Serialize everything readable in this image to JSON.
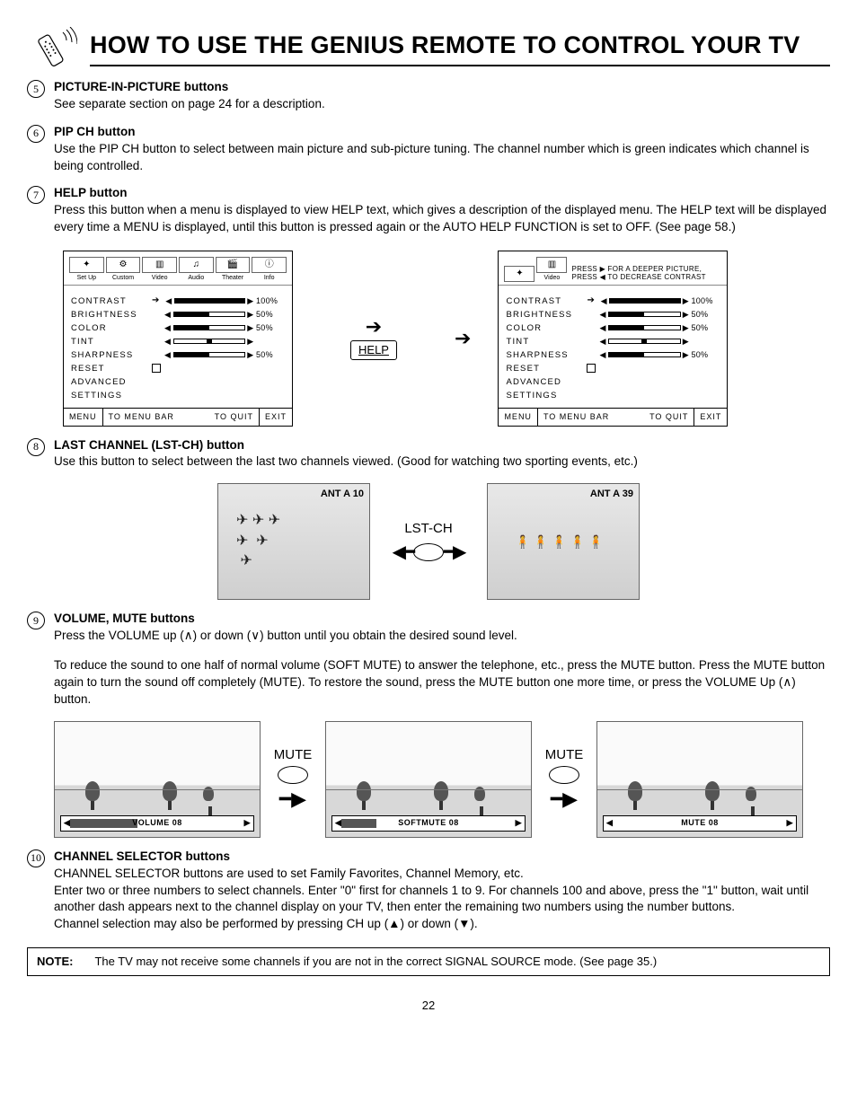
{
  "page": {
    "title": "HOW TO USE THE GENIUS REMOTE TO CONTROL YOUR TV",
    "number": "22"
  },
  "sections": [
    {
      "num": "5",
      "title": "PICTURE-IN-PICTURE buttons",
      "text": "See separate section on page 24 for a description."
    },
    {
      "num": "6",
      "title": "PIP CH button",
      "text": "Use the PIP CH button to select between main picture and sub-picture tuning. The channel number which is green indicates which channel is being controlled."
    },
    {
      "num": "7",
      "title": "HELP button",
      "text": "Press this button when a menu is displayed to view HELP text, which gives a description of the displayed menu. The HELP text will be displayed every time a MENU is displayed, until this button is pressed again or the AUTO HELP FUNCTION is set to OFF. (See page 58.)"
    },
    {
      "num": "8",
      "title": "LAST CHANNEL (LST-CH) button",
      "text": "Use this button to select between the last two channels viewed.  (Good for watching two sporting events, etc.)"
    },
    {
      "num": "9",
      "title": "VOLUME, MUTE buttons",
      "text": "Press the VOLUME up (∧) or down (∨) button until you obtain the desired sound level.",
      "text2": "To reduce the sound to one half of normal volume (SOFT MUTE) to answer the telephone, etc., press the MUTE button.  Press the MUTE button again to turn the sound off completely (MUTE). To restore the sound, press the MUTE button one more time, or press the VOLUME Up (∧) button."
    },
    {
      "num": "10",
      "title": "CHANNEL SELECTOR buttons",
      "text": "CHANNEL SELECTOR buttons are used to set Family Favorites, Channel Memory, etc.",
      "text2": "Enter two or three numbers to select channels.  Enter \"0\" first for channels 1 to 9.  For channels 100 and above, press the \"1\" button, wait until another dash appears next to the channel display on your TV, then enter the remaining two numbers using the number buttons.",
      "text3": "Channel selection may also be performed by pressing CH up (▲) or down (▼)."
    }
  ],
  "menu": {
    "tabs": [
      "Set Up",
      "Custom",
      "Video",
      "Audio",
      "Theater",
      "Info"
    ],
    "tabs2_label": "Video",
    "help_banner": "PRESS ▶ FOR A DEEPER PICTURE, PRESS ◀ TO DECREASE CONTRAST",
    "rows": [
      {
        "label": "CONTRAST",
        "fill": 100,
        "val": "100%",
        "arrow": true
      },
      {
        "label": "BRIGHTNESS",
        "fill": 50,
        "val": "50%"
      },
      {
        "label": "COLOR",
        "fill": 50,
        "val": "50%"
      },
      {
        "label": "TINT",
        "fill": 0,
        "val": "",
        "tint": true
      },
      {
        "label": "SHARPNESS",
        "fill": 50,
        "val": "50%"
      },
      {
        "label": "RESET",
        "check": true
      },
      {
        "label": "ADVANCED"
      },
      {
        "label": " SETTINGS"
      }
    ],
    "footer": {
      "a": "MENU",
      "b": "TO MENU BAR",
      "c": "TO QUIT",
      "d": "EXIT"
    },
    "help_btn": "HELP"
  },
  "lst": {
    "left_label": "ANT A   10",
    "right_label": "ANT A   39",
    "mid": "LST-CH"
  },
  "mute": {
    "label": "MUTE",
    "bars": [
      "VOLUME  08",
      "SOFTMUTE  08",
      "MUTE  08"
    ],
    "fills": [
      35,
      18,
      0
    ]
  },
  "note": {
    "label": "NOTE:",
    "text": "The TV may not receive some channels if you are not in the correct SIGNAL SOURCE mode.  (See page 35.)"
  }
}
